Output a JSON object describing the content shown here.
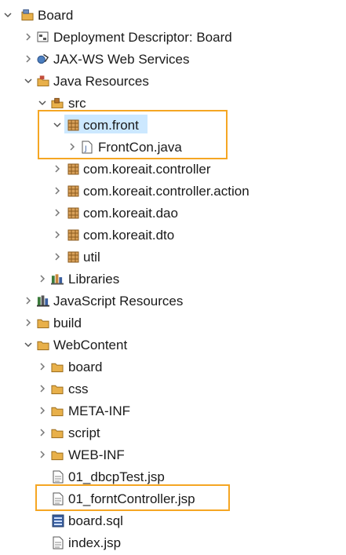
{
  "tree": {
    "project": {
      "label": "Board",
      "icon": "project-icon",
      "expanded": true
    },
    "items": [
      {
        "id": "deployment-descriptor",
        "label": "Deployment Descriptor: Board",
        "icon": "deployment-descriptor-icon",
        "expanded": false
      },
      {
        "id": "jax-ws",
        "label": "JAX-WS Web Services",
        "icon": "web-services-icon",
        "expanded": false
      },
      {
        "id": "java-resources",
        "label": "Java Resources",
        "icon": "java-resources-icon",
        "expanded": true
      },
      {
        "id": "src",
        "label": "src",
        "icon": "source-folder-icon",
        "expanded": true
      },
      {
        "id": "com-front",
        "label": "com.front",
        "icon": "package-icon",
        "expanded": true,
        "selected": true
      },
      {
        "id": "frontcon-java",
        "label": "FrontCon.java",
        "icon": "java-file-icon",
        "expanded": false
      },
      {
        "id": "com-koreait-controller",
        "label": "com.koreait.controller",
        "icon": "package-icon",
        "expanded": false
      },
      {
        "id": "com-koreait-controller-action",
        "label": "com.koreait.controller.action",
        "icon": "package-icon",
        "expanded": false
      },
      {
        "id": "com-koreait-dao",
        "label": "com.koreait.dao",
        "icon": "package-icon",
        "expanded": false
      },
      {
        "id": "com-koreait-dto",
        "label": "com.koreait.dto",
        "icon": "package-icon",
        "expanded": false
      },
      {
        "id": "util",
        "label": "util",
        "icon": "package-icon",
        "expanded": false
      },
      {
        "id": "libraries",
        "label": "Libraries",
        "icon": "libraries-icon",
        "expanded": false
      },
      {
        "id": "javascript-resources",
        "label": "JavaScript Resources",
        "icon": "javascript-resources-icon",
        "expanded": false
      },
      {
        "id": "build",
        "label": "build",
        "icon": "folder-icon",
        "expanded": false
      },
      {
        "id": "webcontent",
        "label": "WebContent",
        "icon": "folder-icon",
        "expanded": true
      },
      {
        "id": "board-folder",
        "label": "board",
        "icon": "folder-icon",
        "expanded": false
      },
      {
        "id": "css",
        "label": "css",
        "icon": "folder-icon",
        "expanded": false
      },
      {
        "id": "meta-inf",
        "label": "META-INF",
        "icon": "folder-icon",
        "expanded": false
      },
      {
        "id": "script",
        "label": "script",
        "icon": "folder-icon",
        "expanded": false
      },
      {
        "id": "web-inf",
        "label": "WEB-INF",
        "icon": "folder-icon",
        "expanded": false
      },
      {
        "id": "dbcptest-jsp",
        "label": "01_dbcpTest.jsp",
        "icon": "jsp-file-icon"
      },
      {
        "id": "forntcontroller-jsp",
        "label": "01_forntController.jsp",
        "icon": "jsp-file-icon"
      },
      {
        "id": "board-sql",
        "label": "board.sql",
        "icon": "sql-file-icon"
      },
      {
        "id": "index-jsp",
        "label": "index.jsp",
        "icon": "jsp-file-icon"
      }
    ]
  },
  "colors": {
    "highlight_border": "#f5a623",
    "selection_bg": "#cce8ff",
    "folder": "#e8b04a",
    "package": "#c9873a"
  }
}
